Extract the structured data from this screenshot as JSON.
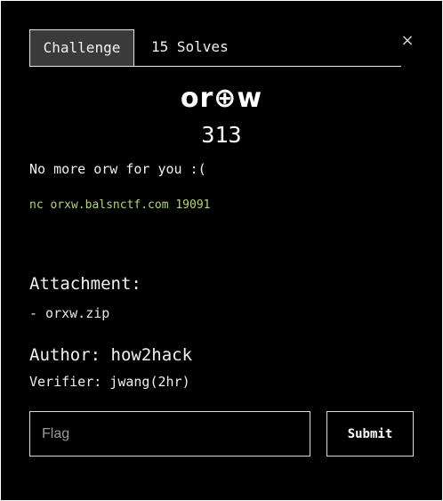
{
  "modal": {
    "close_icon": "×",
    "tabs": [
      {
        "label": "Challenge"
      },
      {
        "label": "15 Solves"
      }
    ],
    "challenge": {
      "name": "or⊕w",
      "value": "313",
      "description": "No more orw for you :(",
      "connection": "nc orxw.balsnctf.com 19091",
      "attachment_heading": "Attachment:",
      "attachment_file": "- orxw.zip",
      "author": "Author: how2hack",
      "verifier": "Verifier: jwang(2hr)"
    },
    "form": {
      "flag_placeholder": "Flag",
      "submit_label": "Submit"
    }
  },
  "colors": {
    "background": "#000000",
    "text": "#ffffff",
    "connection_text": "#b5d86a",
    "active_tab": "#3a3a3a"
  }
}
